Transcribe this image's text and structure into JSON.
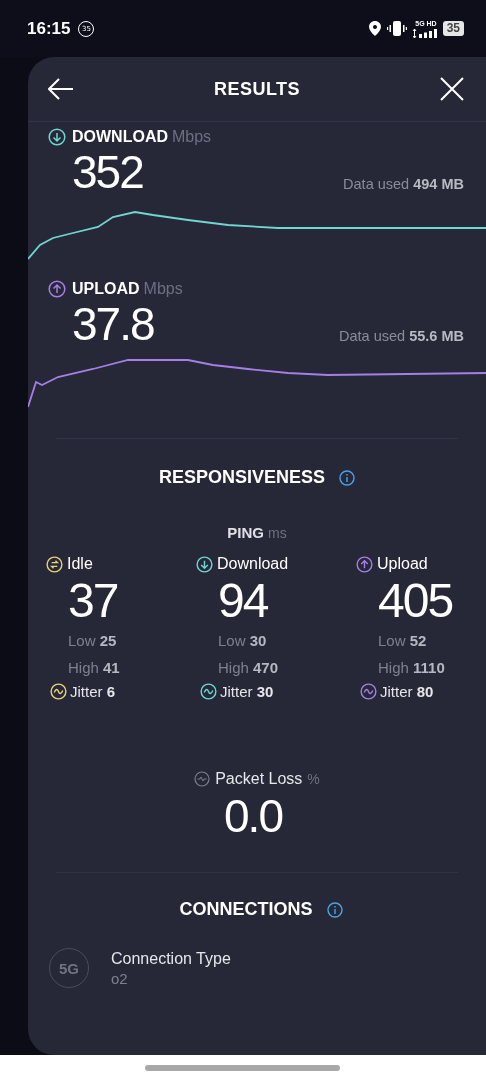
{
  "status_bar": {
    "time": "16:15",
    "notification_badge": "35",
    "network_label": "5G HD",
    "battery": "35"
  },
  "header": {
    "title": "RESULTS"
  },
  "speeds": [
    {
      "kind": "download",
      "label": "DOWNLOAD",
      "unit": "Mbps",
      "value": "352",
      "data_used": "Data used **494 MB**",
      "color": "#6fd6d0"
    },
    {
      "kind": "upload",
      "label": "UPLOAD",
      "unit": "Mbps",
      "value": "37.8",
      "data_used": "Data used **55.6 MB**",
      "color": "#a77ee6"
    }
  ],
  "responsiveness": {
    "title": "RESPONSIVENESS",
    "ping_label": "PING",
    "ping_unit": "ms",
    "columns": [
      {
        "kind": "idle",
        "label": "Idle",
        "value": "37",
        "low": "Low **25**",
        "high": "High **41**",
        "jitter": "Jitter **6**",
        "color": "#e6d37a"
      },
      {
        "kind": "download",
        "label": "Download",
        "value": "94",
        "low": "Low **30**",
        "high": "High **470**",
        "jitter": "Jitter **30**",
        "color": "#6fd6d0"
      },
      {
        "kind": "upload",
        "label": "Upload",
        "value": "405",
        "low": "Low **52**",
        "high": "High **1110**",
        "jitter": "Jitter **80**",
        "color": "#a77ee6"
      }
    ]
  },
  "packet_loss": {
    "label": "Packet Loss",
    "unit": "%",
    "value": "0.0"
  },
  "connections": {
    "title": "CONNECTIONS",
    "items": [
      {
        "kind": "cellular",
        "icon_text": "5G",
        "label": "Connection Type",
        "value": "o2"
      }
    ]
  }
}
